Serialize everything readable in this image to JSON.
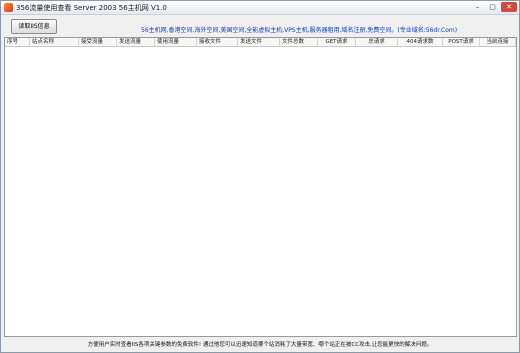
{
  "window": {
    "title": "356流量使用查看 Server 2003 56主机网 V1.0",
    "minimize_glyph": "–",
    "maximize_glyph": "▢",
    "close_glyph": "✕"
  },
  "toolbar": {
    "read_button": "读取IIS信息",
    "ad_links": "56主机网,香港空间,海外空间,美国空间,全能虚拟主机,VPS主机,服务器租用,域名注册,免费空间。(专业域名:56dr.Com)"
  },
  "grid": {
    "columns": [
      "序号",
      "站点名称",
      "接受流量",
      "发送流量",
      "使用流量",
      "接收文件",
      "发送文件",
      "文件总数",
      "GET请求",
      "总请求",
      "404请求数",
      "POST请求",
      "当前连接"
    ]
  },
  "footer": {
    "text": "方便用户实时查看IIS各项关键参数的免费软件! 通过他您可以迅速知道哪个站消耗了大量带宽、哪个站正在被CC攻击,让您能更快的解决问题。"
  },
  "colors": {
    "link": "#0b3cc7",
    "close": "#cf4b3c"
  }
}
